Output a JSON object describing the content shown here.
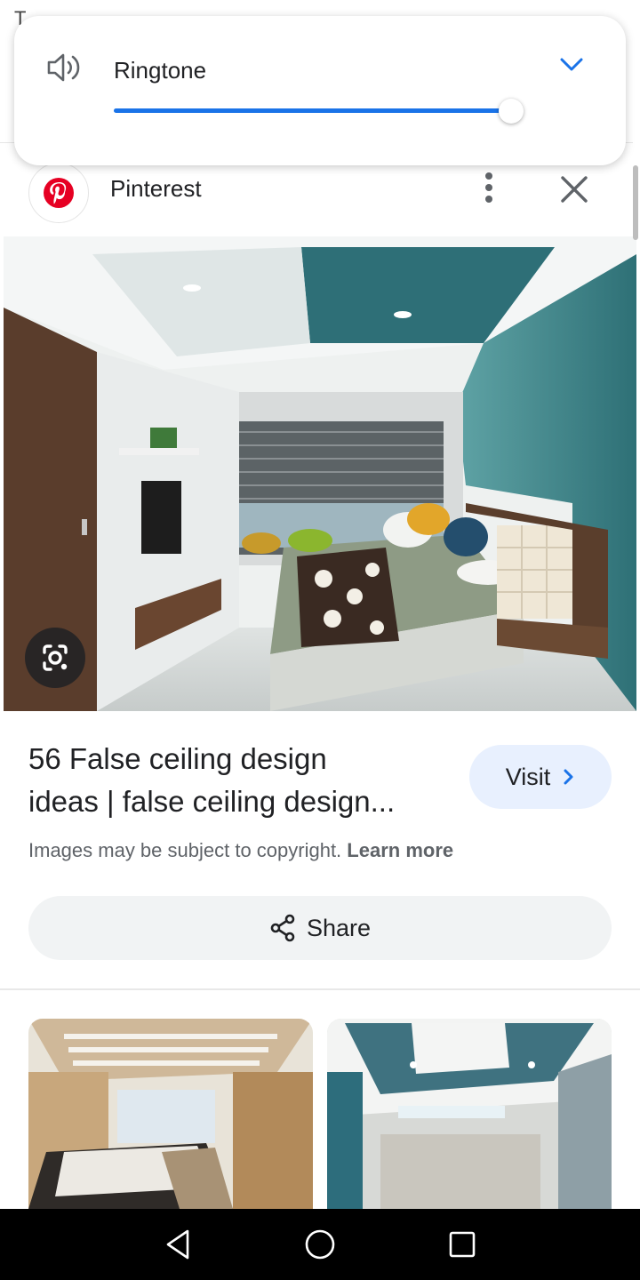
{
  "status_bar": {
    "left_text": "T"
  },
  "volume": {
    "label": "Ringtone",
    "level": 0.98,
    "accent_color": "#1a73e8",
    "icon": "speaker-icon",
    "expand_icon": "chevron-down-icon"
  },
  "header": {
    "source_name": "Pinterest",
    "logo_icon": "pinterest-logo",
    "more_icon": "more-vert-icon",
    "close_icon": "close-icon"
  },
  "main": {
    "image_subject": "bedroom-false-ceiling",
    "lens_icon": "google-lens-icon"
  },
  "result": {
    "title_line1": "56 False ceiling design",
    "title_line2": "ideas | false ceiling design...",
    "visit_label": "Visit",
    "copyright_text": "Images may be subject to copyright.",
    "learn_more": "Learn more",
    "share_label": "Share"
  },
  "related": [
    {
      "subject": "bedroom-wood-ceiling"
    },
    {
      "subject": "teal-false-ceiling"
    }
  ],
  "nav": {
    "back_icon": "back-triangle-icon",
    "home_icon": "home-circle-icon",
    "recents_icon": "recents-square-icon"
  }
}
